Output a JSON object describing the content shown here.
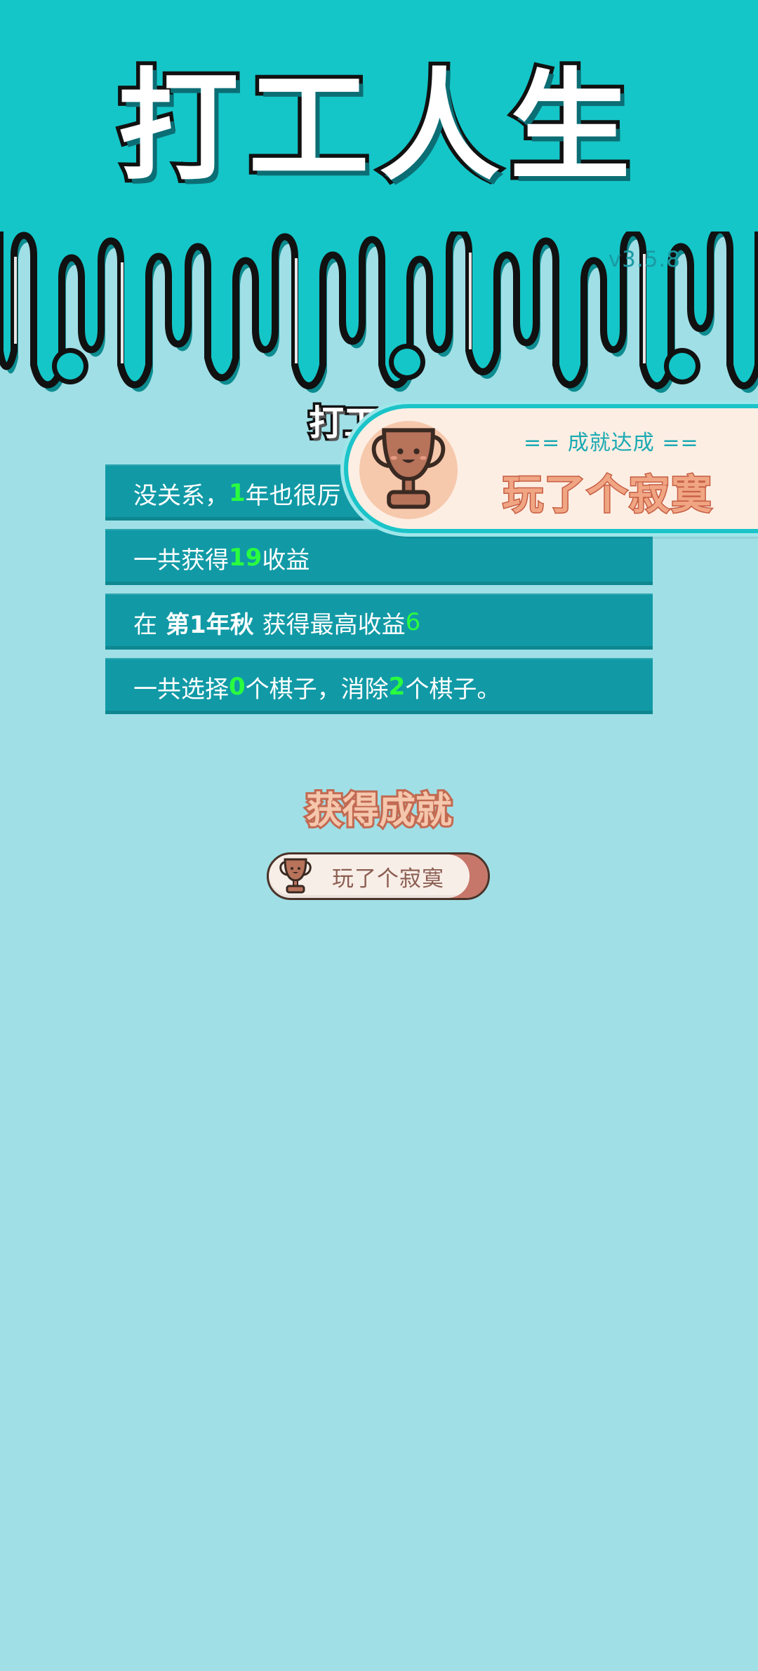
{
  "header": {
    "title": "打工人生",
    "version": "v3.5.8"
  },
  "summary": {
    "title": "打工"
  },
  "stats": [
    {
      "pre": "没关系，",
      "num": "1",
      "post": "年也很厉"
    },
    {
      "pre": "一共获得",
      "num": "19",
      "post": "收益"
    },
    {
      "pre": "在",
      "bold": "第1年秋",
      "mid": "获得最高收益",
      "num": "6"
    },
    {
      "pre": "一共选择",
      "num": "0",
      "mid": "个棋子，消除",
      "num2": "2",
      "post": "个棋子。"
    }
  ],
  "achievements": {
    "heading": "获得成就",
    "badge_label": "玩了个寂寞",
    "icon": "trophy-icon"
  },
  "toast": {
    "subtitle": "== 成就达成 ==",
    "title": "玩了个寂寞",
    "icon": "trophy-icon"
  },
  "colors": {
    "teal": "#14c6c8",
    "background": "#a0dfe6",
    "row": "#119aa6",
    "highlight": "#2aff3e",
    "achievement": "#c7776a"
  }
}
